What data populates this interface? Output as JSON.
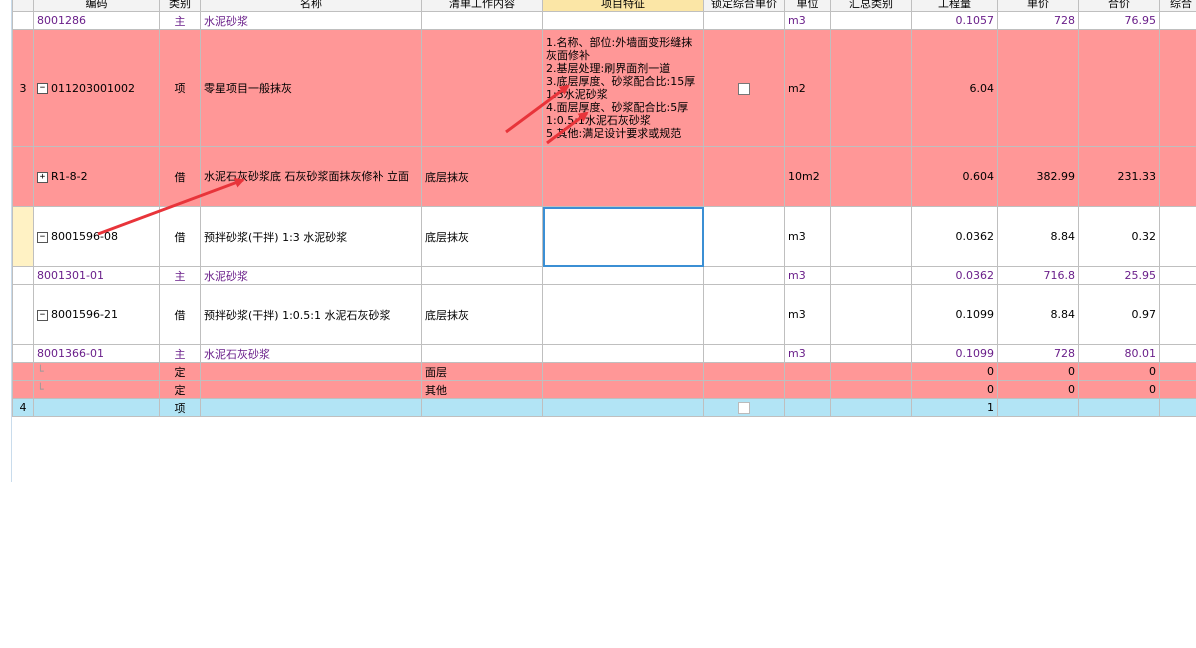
{
  "header": [
    "编码",
    "类别",
    "名称",
    "清单工作内容",
    "项目特征",
    "锁定综合单价",
    "单位",
    "汇总类别",
    "工程量",
    "单价",
    "合价",
    "综合"
  ],
  "rows": [
    {
      "idx": "",
      "code": "8001286",
      "cat": "主",
      "name": "水泥砂浆",
      "work": "",
      "feat": "",
      "unit": "m3",
      "qty": "0.1057",
      "price": "728",
      "total": "76.95"
    },
    {
      "idx": "3",
      "code": "011203001002",
      "cat": "项",
      "name": "零星项目一般抹灰",
      "work": "",
      "feat": "1.名称、部位:外墙面变形缝抹灰面修补\n2.基层处理:刷界面剂一道\n3.底层厚度、砂浆配合比:15厚1:3水泥砂浆\n4.面层厚度、砂浆配合比:5厚1:0.5:1水泥石灰砂浆\n5.其他:满足设计要求或规范",
      "unit": "m2",
      "qty": "6.04",
      "price": "",
      "total": ""
    },
    {
      "idx": "",
      "code": "R1-8-2",
      "cat": "借",
      "name": "水泥石灰砂浆底 石灰砂浆面抹灰修补 立面",
      "work": "底层抹灰",
      "feat": "",
      "unit": "10m2",
      "qty": "0.604",
      "price": "382.99",
      "total": "231.33"
    },
    {
      "idx": "",
      "code": "8001596-08",
      "cat": "借",
      "name": "预拌砂浆(干拌) 1:3 水泥砂浆",
      "work": "底层抹灰",
      "feat": "",
      "unit": "m3",
      "qty": "0.0362",
      "price": "8.84",
      "total": "0.32"
    },
    {
      "idx": "",
      "code": "8001301-01",
      "cat": "主",
      "name": "水泥砂浆",
      "work": "",
      "feat": "",
      "unit": "m3",
      "qty": "0.0362",
      "price": "716.8",
      "total": "25.95"
    },
    {
      "idx": "",
      "code": "8001596-21",
      "cat": "借",
      "name": "预拌砂浆(干拌) 1:0.5:1 水泥石灰砂浆",
      "work": "底层抹灰",
      "feat": "",
      "unit": "m3",
      "qty": "0.1099",
      "price": "8.84",
      "total": "0.97"
    },
    {
      "idx": "",
      "code": "8001366-01",
      "cat": "主",
      "name": "水泥石灰砂浆",
      "work": "",
      "feat": "",
      "unit": "m3",
      "qty": "0.1099",
      "price": "728",
      "total": "80.01"
    },
    {
      "idx": "",
      "code": "",
      "cat": "定",
      "name": "",
      "work": "面层",
      "feat": "",
      "unit": "",
      "qty": "0",
      "price": "0",
      "total": "0"
    },
    {
      "idx": "",
      "code": "",
      "cat": "定",
      "name": "",
      "work": "其他",
      "feat": "",
      "unit": "",
      "qty": "0",
      "price": "0",
      "total": "0"
    },
    {
      "idx": "4",
      "code": "",
      "cat": "项",
      "name": "",
      "work": "",
      "feat": "",
      "unit": "",
      "qty": "1",
      "price": "",
      "total": ""
    }
  ],
  "colors": {
    "red_row": "#ff9797",
    "blue_row": "#b2e4f5",
    "sub_text": "#6a1f8a",
    "arrow": "#e8343a"
  }
}
